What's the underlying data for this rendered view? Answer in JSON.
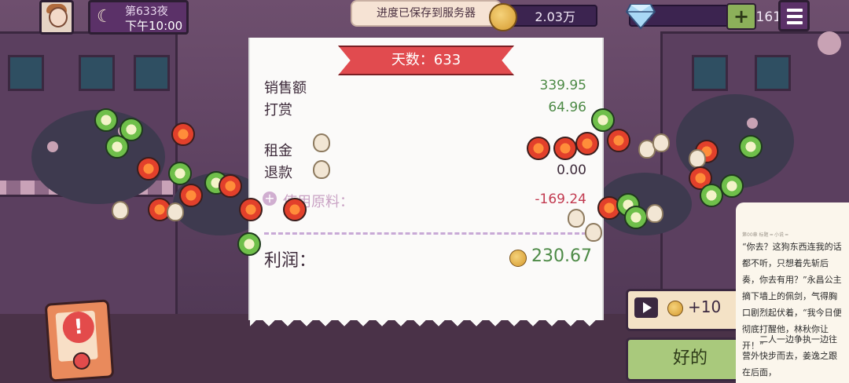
{
  "top": {
    "day_label": "第633夜",
    "time_label": "下午10:00",
    "toast": "进度已保存到服务器",
    "coins": "2.03万",
    "diamonds": "161",
    "plus": "+"
  },
  "receipt": {
    "ribbon": "天数：633",
    "sales_label": "销售额",
    "sales_value": "339.95",
    "tips_label": "打赏",
    "tips_value": "64.96",
    "rent_label": "租金",
    "rent_value": "-",
    "refund_label": "退款",
    "refund_value": "0.00",
    "ingredients_label": "使用原料：",
    "ingredients_value": "-169.24",
    "profit_label": "利润：",
    "profit_value": "230.67"
  },
  "ad": {
    "reward": "+10"
  },
  "ok_button": "好的",
  "reader": {
    "header": "第00章 标题     ━ 小说 ━",
    "para1": "“你去？这狗东西连我的话都不听，只想着先斩后奏，你去有用？”永昌公主摘下墙上的佩剑，气得胸口剧烈起伏着，“我今日便彻底打醒他，林秋你让开！”",
    "para2": "二人一边争执一边往营外快步而去，姜逸之跟在后面，"
  },
  "icons": [
    "moon-icon",
    "coin-icon",
    "diamond-icon",
    "menu-icon",
    "play-icon",
    "alert-icon"
  ]
}
